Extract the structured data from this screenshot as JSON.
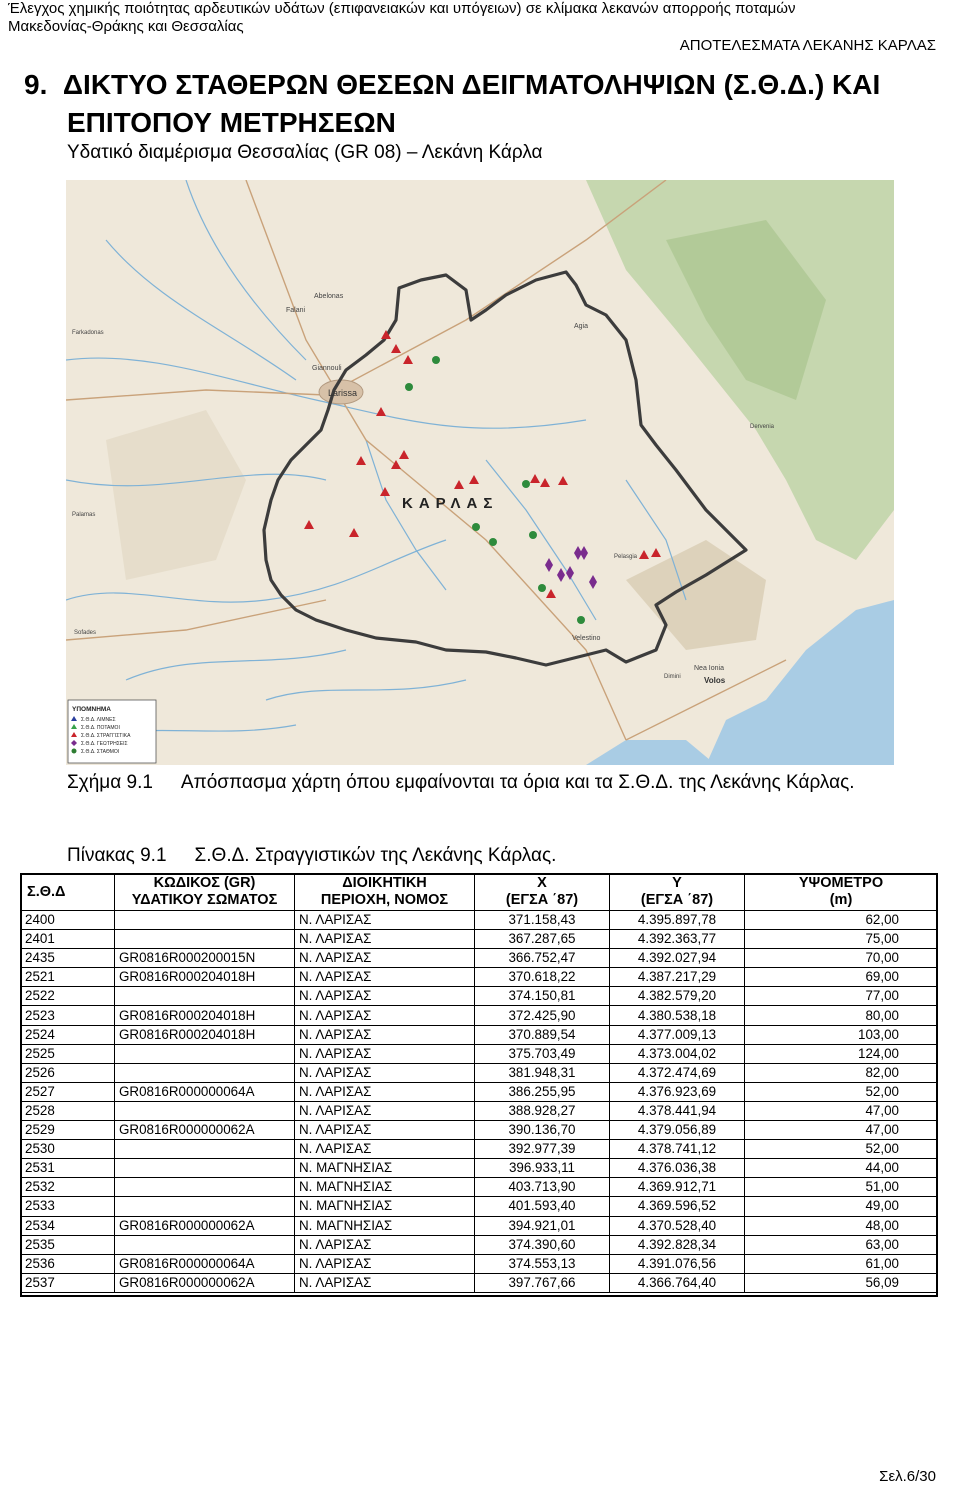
{
  "header": {
    "line1": "Έλεγχος χημικής ποιότητας αρδευτικών υδάτων (επιφανειακών και υπόγειων) σε κλίμακα λεκανών απορροής ποταμών",
    "line2": "Μακεδονίας-Θράκης και Θεσσαλίας",
    "right": "ΑΠΟΤΕΛΕΣΜΑΤΑ ΛΕΚΑΝΗΣ ΚΑΡΛΑΣ"
  },
  "section": {
    "number": "9.",
    "title_line1": "ΔΙΚΤΥΟ ΣΤΑΘΕΡΩΝ ΘΕΣΕΩΝ ΔΕΙΓΜΑΤΟΛΗΨΙΩΝ (Σ.Θ.Δ.) ΚΑΙ",
    "title_line2": "ΕΠΙΤΟΠΟΥ ΜΕΤΡΗΣΕΩΝ",
    "subtitle": "Υδατικό διαμέρισμα Θεσσαλίας (GR 08) – Λεκάνη Κάρλα"
  },
  "map": {
    "basin_label": "ΚΑΡΛΑΣ",
    "legend_title": "ΥΠΟΜΝΗΜΑ",
    "legend_items": [
      {
        "label": "Σ.Θ.Δ. ΛΙΜΝΕΣ",
        "color": "#2b3f9e"
      },
      {
        "label": "Σ.Θ.Δ. ΠΟΤΑΜΟΙ",
        "color": "#36a24a"
      },
      {
        "label": "Σ.Θ.Δ. ΣΤΡΑΓΓΙΣΤΙΚΑ",
        "color": "#c9242b"
      },
      {
        "label": "Σ.Θ.Δ. ΓΕΩΤΡΗΣΕΙΣ",
        "color": "#7a2c8e"
      },
      {
        "label": "Σ.Θ.Δ. ΣΤΑΘΜΟΙ",
        "color": "#2e7d32"
      }
    ],
    "places": [
      "Larissa",
      "Giannouli",
      "Falani",
      "Abelonas",
      "Agia",
      "Velestino",
      "Nea Ionia",
      "Volos",
      "Dimini",
      "Pelasgia",
      "Farkadonas",
      "Palamas",
      "Sofades",
      "Dervenia"
    ],
    "colors": {
      "sea": "#a9cce4",
      "land": "#efe8da",
      "hills": "#d8ccb3",
      "forest": "#bcd2a4",
      "boundary": "#3c3c3c",
      "river": "#7fb2d6"
    }
  },
  "figure_caption": {
    "label": "Σχήμα 9.1",
    "text": "Απόσπασμα χάρτη όπου εμφαίνονται τα όρια και τα Σ.Θ.Δ. της Λεκάνης Κάρλας."
  },
  "table_caption": {
    "label": "Πίνακας 9.1",
    "text": "Σ.Θ.Δ. Στραγγιστικών της Λεκάνης Κάρλας."
  },
  "table": {
    "headers": {
      "std": "Σ.Θ.Δ",
      "code_l1": "ΚΩΔΙΚΟΣ (GR)",
      "code_l2": "ΥΔΑΤΙΚΟΥ ΣΩΜΑΤΟΣ",
      "admin_l1": "ΔΙΟΙΚΗΤΙΚΗ",
      "admin_l2": "ΠΕΡΙΟΧΗ, ΝΟΜΟΣ",
      "x_l1": "X",
      "x_l2": "(ΕΓΣΑ ΄87)",
      "y_l1": "Y",
      "y_l2": "(ΕΓΣΑ ΄87)",
      "alt_l1": "ΥΨΟΜΕΤΡΟ",
      "alt_l2": "(m)"
    },
    "rows": [
      {
        "std": "2400",
        "code": "",
        "admin": "Ν. ΛΑΡΙΣΑΣ",
        "x": "371.158,43",
        "y": "4.395.897,78",
        "alt": "62,00"
      },
      {
        "std": "2401",
        "code": "",
        "admin": "Ν. ΛΑΡΙΣΑΣ",
        "x": "367.287,65",
        "y": "4.392.363,77",
        "alt": "75,00"
      },
      {
        "std": "2435",
        "code": "GR0816R000200015N",
        "admin": "Ν. ΛΑΡΙΣΑΣ",
        "x": "366.752,47",
        "y": "4.392.027,94",
        "alt": "70,00"
      },
      {
        "std": "2521",
        "code": "GR0816R000204018H",
        "admin": "Ν. ΛΑΡΙΣΑΣ",
        "x": "370.618,22",
        "y": "4.387.217,29",
        "alt": "69,00"
      },
      {
        "std": "2522",
        "code": "",
        "admin": "Ν. ΛΑΡΙΣΑΣ",
        "x": "374.150,81",
        "y": "4.382.579,20",
        "alt": "77,00"
      },
      {
        "std": "2523",
        "code": "GR0816R000204018H",
        "admin": "Ν. ΛΑΡΙΣΑΣ",
        "x": "372.425,90",
        "y": "4.380.538,18",
        "alt": "80,00"
      },
      {
        "std": "2524",
        "code": "GR0816R000204018H",
        "admin": "Ν. ΛΑΡΙΣΑΣ",
        "x": "370.889,54",
        "y": "4.377.009,13",
        "alt": "103,00"
      },
      {
        "std": "2525",
        "code": "",
        "admin": "Ν. ΛΑΡΙΣΑΣ",
        "x": "375.703,49",
        "y": "4.373.004,02",
        "alt": "124,00"
      },
      {
        "std": "2526",
        "code": "",
        "admin": "Ν. ΛΑΡΙΣΑΣ",
        "x": "381.948,31",
        "y": "4.372.474,69",
        "alt": "82,00"
      },
      {
        "std": "2527",
        "code": "GR0816R000000064A",
        "admin": "Ν. ΛΑΡΙΣΑΣ",
        "x": "386.255,95",
        "y": "4.376.923,69",
        "alt": "52,00"
      },
      {
        "std": "2528",
        "code": "",
        "admin": "Ν. ΛΑΡΙΣΑΣ",
        "x": "388.928,27",
        "y": "4.378.441,94",
        "alt": "47,00"
      },
      {
        "std": "2529",
        "code": "GR0816R000000062A",
        "admin": "Ν. ΛΑΡΙΣΑΣ",
        "x": "390.136,70",
        "y": "4.379.056,89",
        "alt": "47,00"
      },
      {
        "std": "2530",
        "code": "",
        "admin": "Ν. ΛΑΡΙΣΑΣ",
        "x": "392.977,39",
        "y": "4.378.741,12",
        "alt": "52,00"
      },
      {
        "std": "2531",
        "code": "",
        "admin": "Ν. ΜΑΓΝΗΣΙΑΣ",
        "x": "396.933,11",
        "y": "4.376.036,38",
        "alt": "44,00"
      },
      {
        "std": "2532",
        "code": "",
        "admin": "Ν. ΜΑΓΝΗΣΙΑΣ",
        "x": "403.713,90",
        "y": "4.369.912,71",
        "alt": "51,00"
      },
      {
        "std": "2533",
        "code": "",
        "admin": "Ν. ΜΑΓΝΗΣΙΑΣ",
        "x": "401.593,40",
        "y": "4.369.596,52",
        "alt": "49,00"
      },
      {
        "std": "2534",
        "code": "GR0816R000000062A",
        "admin": "Ν. ΜΑΓΝΗΣΙΑΣ",
        "x": "394.921,01",
        "y": "4.370.528,40",
        "alt": "48,00"
      },
      {
        "std": "2535",
        "code": "",
        "admin": "Ν. ΛΑΡΙΣΑΣ",
        "x": "374.390,60",
        "y": "4.392.828,34",
        "alt": "63,00"
      },
      {
        "std": "2536",
        "code": "GR0816R000000064A",
        "admin": "Ν. ΛΑΡΙΣΑΣ",
        "x": "374.553,13",
        "y": "4.391.076,56",
        "alt": "61,00"
      },
      {
        "std": "2537",
        "code": "GR0816R000000062A",
        "admin": "Ν. ΛΑΡΙΣΑΣ",
        "x": "397.767,66",
        "y": "4.366.764,40",
        "alt": "56,09"
      }
    ]
  },
  "footer": {
    "page": "Σελ.6/30"
  }
}
